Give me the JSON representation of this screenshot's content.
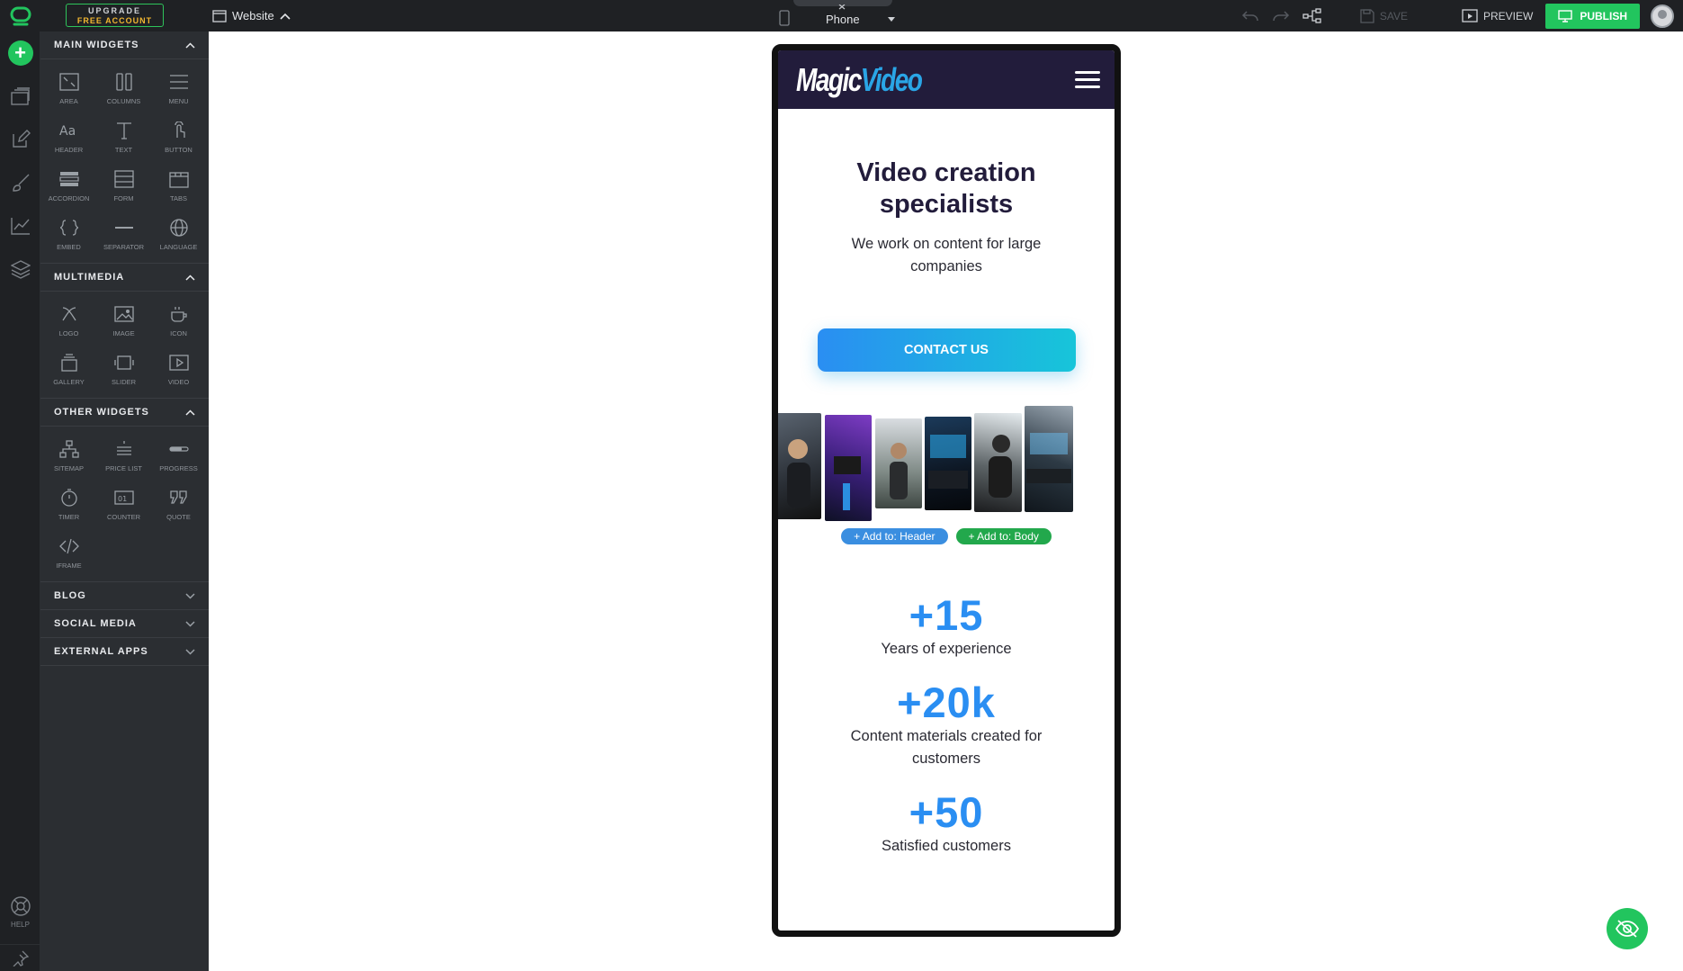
{
  "topbar": {
    "upgrade_line1": "UPGRADE",
    "upgrade_line2": "FREE ACCOUNT",
    "site_selector": "Website",
    "device": "Phone",
    "save": "SAVE",
    "preview": "PREVIEW",
    "publish": "PUBLISH"
  },
  "rail": {
    "help": "HELP"
  },
  "panel": {
    "sections": [
      {
        "title": "MAIN WIDGETS",
        "widgets": [
          "AREA",
          "COLUMNS",
          "MENU",
          "HEADER",
          "TEXT",
          "BUTTON",
          "ACCORDION",
          "FORM",
          "TABS",
          "EMBED",
          "SEPARATOR",
          "LANGUAGE"
        ]
      },
      {
        "title": "MULTIMEDIA",
        "widgets": [
          "LOGO",
          "IMAGE",
          "ICON",
          "GALLERY",
          "SLIDER",
          "VIDEO"
        ]
      },
      {
        "title": "OTHER WIDGETS",
        "widgets": [
          "SITEMAP",
          "PRICE LIST",
          "PROGRESS",
          "TIMER",
          "COUNTER",
          "QUOTE",
          "IFRAME"
        ]
      },
      {
        "title": "BLOG"
      },
      {
        "title": "SOCIAL MEDIA"
      },
      {
        "title": "EXTERNAL APPS"
      }
    ]
  },
  "site": {
    "logo_part1": "Magic",
    "logo_part2": "Video",
    "hero_title": "Video creation specialists",
    "hero_subtitle": "We work on content for large companies",
    "cta": "CONTACT US",
    "add_header": "+ Add to: Header",
    "add_body": "+ Add to: Body",
    "stats": [
      {
        "number": "+15",
        "label": "Years of experience"
      },
      {
        "number": "+20k",
        "label": "Content materials created for customers"
      },
      {
        "number": "+50",
        "label": "Satisfied customers"
      }
    ]
  },
  "colors": {
    "accent_green": "#22c55e",
    "brand_dark": "#221c3b",
    "brand_blue": "#2a8ef2"
  }
}
